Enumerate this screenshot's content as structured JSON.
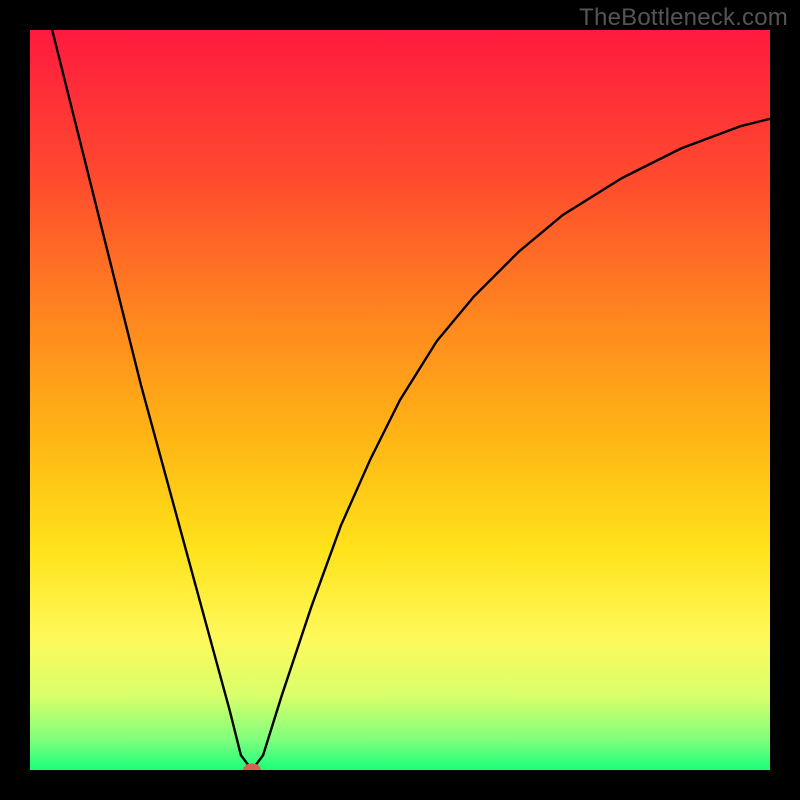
{
  "watermark": "TheBottleneck.com",
  "chart_data": {
    "type": "line",
    "title": "",
    "xlabel": "",
    "ylabel": "",
    "xlim": [
      0,
      100
    ],
    "ylim": [
      0,
      100
    ],
    "background_gradient": {
      "stops": [
        {
          "pos": 0.0,
          "color": "#ff1a3f"
        },
        {
          "pos": 0.2,
          "color": "#ff4a2e"
        },
        {
          "pos": 0.4,
          "color": "#ff8a1e"
        },
        {
          "pos": 0.55,
          "color": "#ffb514"
        },
        {
          "pos": 0.7,
          "color": "#ffe21a"
        },
        {
          "pos": 0.82,
          "color": "#fff95a"
        },
        {
          "pos": 0.9,
          "color": "#d8ff6a"
        },
        {
          "pos": 0.96,
          "color": "#7dff7d"
        },
        {
          "pos": 1.0,
          "color": "#1aff7a"
        }
      ]
    },
    "series": [
      {
        "name": "curve",
        "color": "#000000",
        "x": [
          3,
          6,
          9,
          12,
          15,
          18,
          21,
          24,
          27,
          28.5,
          30,
          31.5,
          34,
          38,
          42,
          46,
          50,
          55,
          60,
          66,
          72,
          80,
          88,
          96,
          100
        ],
        "y": [
          100,
          88,
          76,
          64,
          52,
          41,
          30,
          19,
          8,
          2,
          0,
          2,
          10,
          22,
          33,
          42,
          50,
          58,
          64,
          70,
          75,
          80,
          84,
          87,
          88
        ]
      }
    ],
    "marker": {
      "x": 30,
      "y": 0,
      "rx": 1.2,
      "ry": 0.9,
      "color": "#d4634f"
    }
  }
}
